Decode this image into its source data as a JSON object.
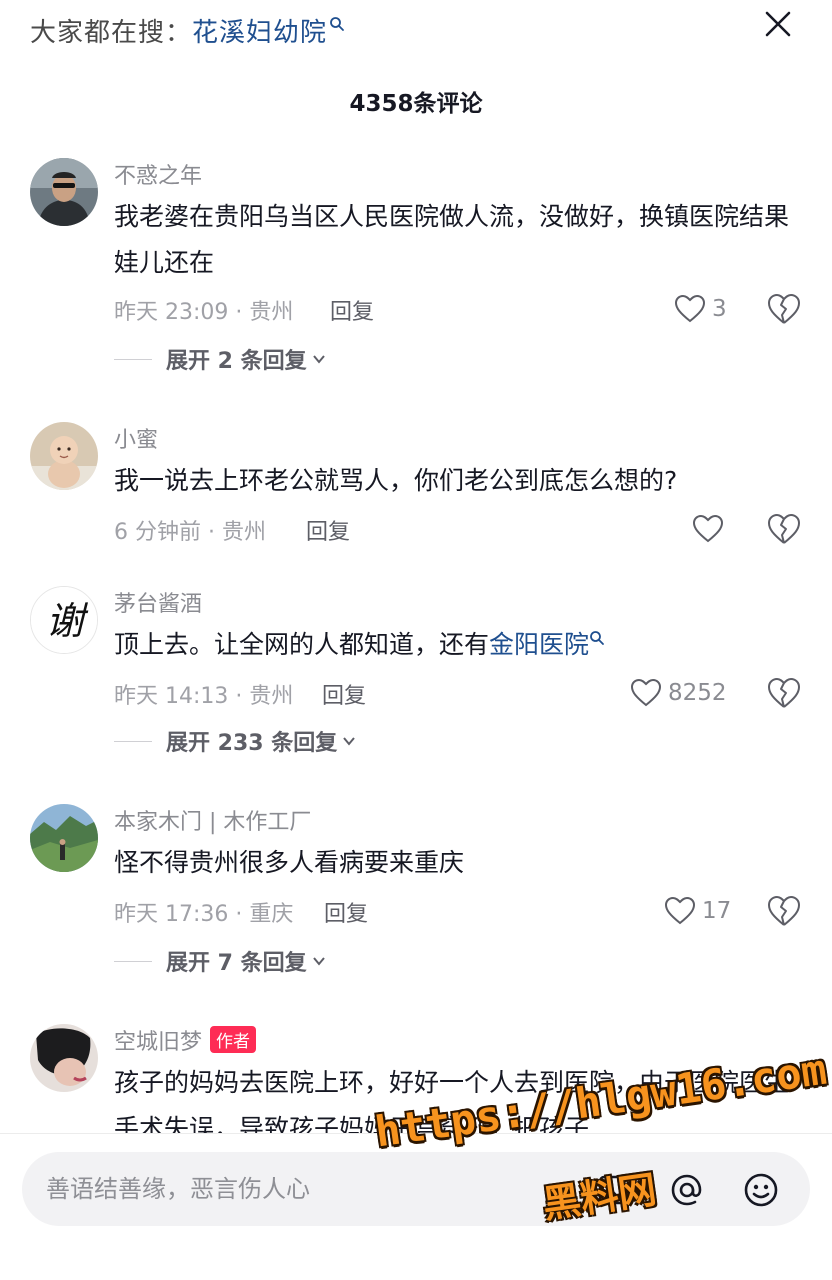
{
  "header": {
    "search_prefix": "大家都在搜：",
    "search_keyword": "花溪妇幼院",
    "comment_count": "4358条评论"
  },
  "comments": [
    {
      "username": "不惑之年",
      "text": "我老婆在贵阳乌当区人民医院做人流，没做好，换镇医院结果娃儿还在",
      "time_location": "昨天 23:09 · 贵州",
      "reply_label": "回复",
      "likes": "3",
      "expand_label": "展开 2 条回复"
    },
    {
      "username": "小蜜",
      "text": "我一说去上环老公就骂人，你们老公到底怎么想的?",
      "time_location": "6 分钟前 · 贵州",
      "reply_label": "回复",
      "likes": ""
    },
    {
      "username": "茅台酱酒",
      "text_prefix": "顶上去。让全网的人都知道，还有",
      "text_keyword": "金阳医院",
      "time_location": "昨天 14:13 · 贵州",
      "reply_label": "回复",
      "likes": "8252",
      "expand_label": "展开 233 条回复",
      "avatar_char": "谢"
    },
    {
      "username": "本家木门 | 木作工厂",
      "text": "怪不得贵州很多人看病要来重庆",
      "time_location": "昨天 17:36 · 重庆",
      "reply_label": "回复",
      "likes": "17",
      "expand_label": "展开 7 条回复"
    },
    {
      "username": "空城旧梦",
      "author_tag": "作者",
      "text": "孩子的妈妈去医院上环，好好一个人去到医院，由于医院医生手术失误，导致孩子妈妈子宫穿孔，把孩子..."
    }
  ],
  "input": {
    "placeholder": "善语结善缘，恶言伤人心"
  },
  "icons": {
    "close": "close-icon",
    "search_mini": "search-icon",
    "like": "heart-outline-icon",
    "dislike": "broken-heart-icon",
    "image": "image-icon",
    "mention": "at-icon",
    "emoji": "emoji-icon"
  },
  "watermark": {
    "url": "https://hlgw16.com",
    "name": "黑料网"
  }
}
